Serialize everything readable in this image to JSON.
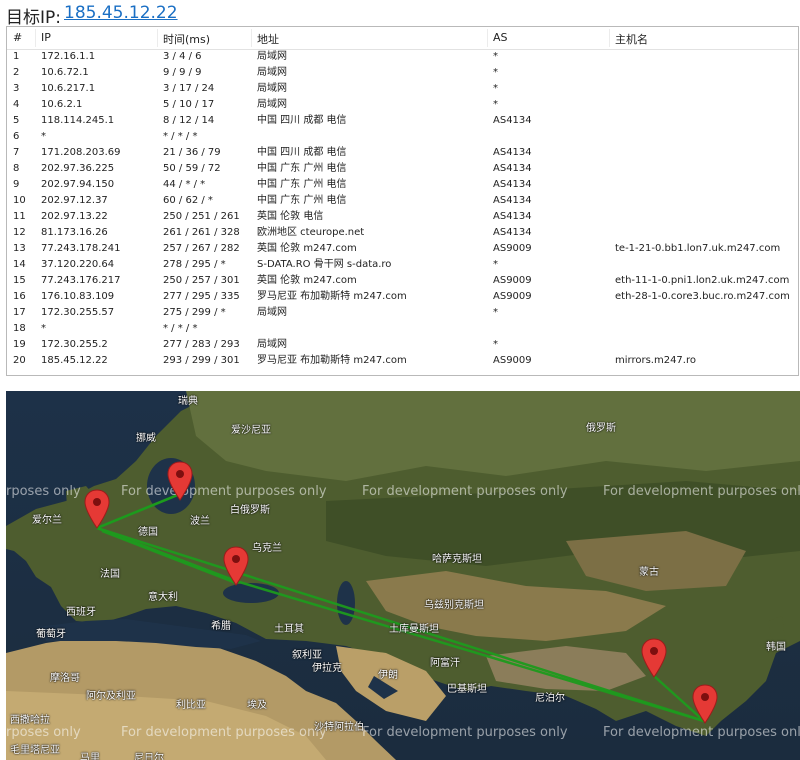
{
  "header": {
    "label": "目标IP:",
    "ip": "185.45.12.22"
  },
  "table": {
    "columns": [
      "#",
      "IP",
      "时间(ms)",
      "地址",
      "AS",
      "主机名"
    ],
    "rows": [
      [
        "1",
        "172.16.1.1",
        "3 / 4 / 6",
        "局域网",
        "*",
        ""
      ],
      [
        "2",
        "10.6.72.1",
        "9 / 9 / 9",
        "局域网",
        "*",
        ""
      ],
      [
        "3",
        "10.6.217.1",
        "3 / 17 / 24",
        "局域网",
        "*",
        ""
      ],
      [
        "4",
        "10.6.2.1",
        "5 / 10 / 17",
        "局域网",
        "*",
        ""
      ],
      [
        "5",
        "118.114.245.1",
        "8 / 12 / 14",
        "中国 四川 成都 电信",
        "AS4134",
        ""
      ],
      [
        "6",
        "*",
        "* / * / *",
        "",
        "",
        ""
      ],
      [
        "7",
        "171.208.203.69",
        "21 / 36 / 79",
        "中国 四川 成都 电信",
        "AS4134",
        ""
      ],
      [
        "8",
        "202.97.36.225",
        "50 / 59 / 72",
        "中国 广东 广州 电信",
        "AS4134",
        ""
      ],
      [
        "9",
        "202.97.94.150",
        "44 / * / *",
        "中国 广东 广州 电信",
        "AS4134",
        ""
      ],
      [
        "10",
        "202.97.12.37",
        "60 / 62 / *",
        "中国 广东 广州 电信",
        "AS4134",
        ""
      ],
      [
        "11",
        "202.97.13.22",
        "250 / 251 / 261",
        "英国 伦敦 电信",
        "AS4134",
        ""
      ],
      [
        "12",
        "81.173.16.26",
        "261 / 261 / 328",
        "欧洲地区 cteurope.net",
        "AS4134",
        ""
      ],
      [
        "13",
        "77.243.178.241",
        "257 / 267 / 282",
        "英国 伦敦 m247.com",
        "AS9009",
        "te-1-21-0.bb1.lon7.uk.m247.com"
      ],
      [
        "14",
        "37.120.220.64",
        "278 / 295 / *",
        "S-DATA.RO 骨干网 s-data.ro",
        "*",
        ""
      ],
      [
        "15",
        "77.243.176.217",
        "250 / 257 / 301",
        "英国 伦敦 m247.com",
        "AS9009",
        "eth-11-1-0.pni1.lon2.uk.m247.com"
      ],
      [
        "16",
        "176.10.83.109",
        "277 / 295 / 335",
        "罗马尼亚 布加勒斯特 m247.com",
        "AS9009",
        "eth-28-1-0.core3.buc.ro.m247.com"
      ],
      [
        "17",
        "172.30.255.57",
        "275 / 299 / *",
        "局域网",
        "*",
        ""
      ],
      [
        "18",
        "*",
        "* / * / *",
        "",
        "",
        ""
      ],
      [
        "19",
        "172.30.255.2",
        "277 / 283 / 293",
        "局域网",
        "*",
        ""
      ],
      [
        "20",
        "185.45.12.22",
        "293 / 299 / 301",
        "罗马尼亚 布加勒斯特 m247.com",
        "AS9009",
        "mirrors.m247.ro"
      ]
    ]
  },
  "map": {
    "watermark": "For development purposes only",
    "watermark_fragment": "rposes only",
    "labels": {
      "ruidian": "瑞典",
      "nuowei": "挪威",
      "aishaniya": "爱沙尼亚",
      "eluosi": "俄罗斯",
      "aierlan": "爱尔兰",
      "boluan": "波兰",
      "deguo": "德国",
      "baieluosi": "白俄罗斯",
      "wukelan": "乌克兰",
      "faguo": "法国",
      "hasakesitan": "哈萨克斯坦",
      "menggu": "蒙古",
      "yidali": "意大利",
      "xibanya": "西班牙",
      "putaoya": "葡萄牙",
      "tuerqi": "土耳其",
      "wuzibiekesitan": "乌兹别克斯坦",
      "xila": "希腊",
      "tukumansitan": "土库曼斯坦",
      "xuliya": "叙利亚",
      "yilake": "伊拉克",
      "afuhan": "阿富汗",
      "hanguo": "韩国",
      "moluoge": "摩洛哥",
      "aerjiliya": "阿尔及利亚",
      "libiya": "利比亚",
      "aiji": "埃及",
      "yilang": "伊朗",
      "bajisitan": "巴基斯坦",
      "nibier": "尼泊尔",
      "shatealabo": "沙特阿拉伯",
      "xisahala": "西撒哈拉",
      "maolitaniya": "毛里塔尼亚",
      "mali": "马里",
      "nirier": "尼日尔"
    }
  }
}
